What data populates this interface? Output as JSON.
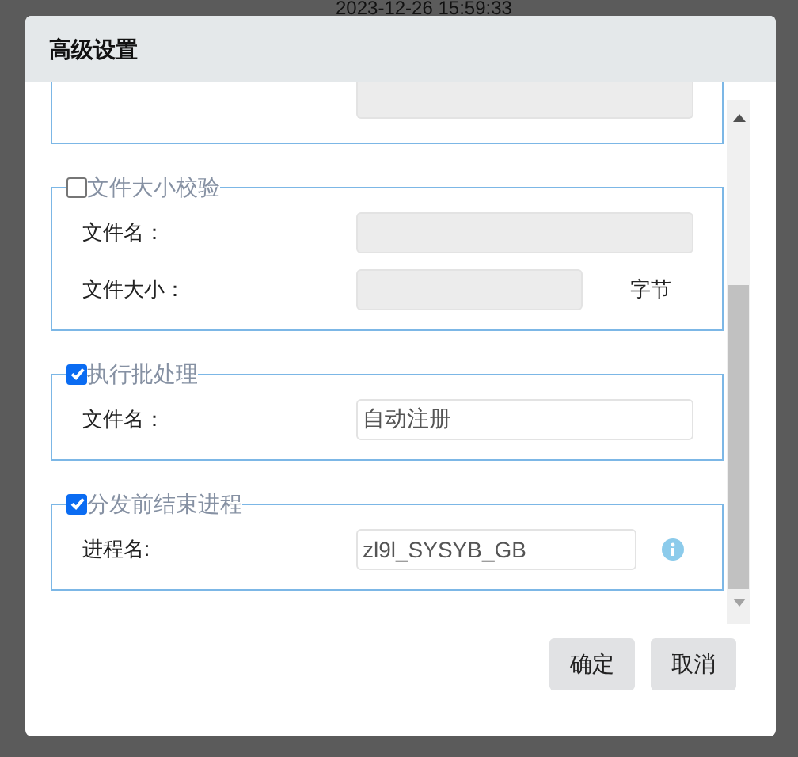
{
  "background": {
    "timestamp": "2023-12-26 15:59:33"
  },
  "dialog": {
    "title": "高级设置"
  },
  "sections": [
    {
      "kind": "cut",
      "fields": [
        {
          "disabled": true
        }
      ]
    },
    {
      "kind": "group",
      "legend": "文件大小校验",
      "checked": false,
      "fields": [
        {
          "label": "文件名：",
          "disabled": true
        },
        {
          "label": "文件大小：",
          "disabled": true,
          "unit": "字节"
        }
      ]
    },
    {
      "kind": "group",
      "legend": "执行批处理",
      "checked": true,
      "fields": [
        {
          "label": "文件名：",
          "value": "自动注册",
          "disabled": false
        }
      ]
    },
    {
      "kind": "group",
      "legend": "分发前结束进程",
      "checked": true,
      "fields": [
        {
          "label": "进程名:",
          "value": "zl9l_SYSYB_GB",
          "disabled": false,
          "info": true
        }
      ]
    }
  ],
  "buttons": [
    "确定",
    "取消"
  ]
}
